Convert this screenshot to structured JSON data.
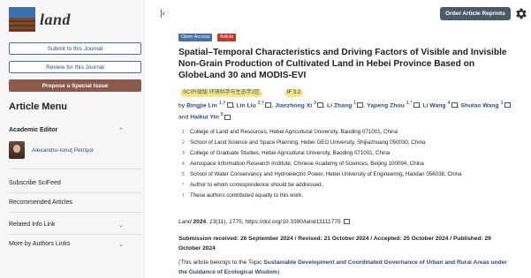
{
  "journal": {
    "name": "land"
  },
  "sidebar": {
    "submit_label": "Submit to this Journal",
    "review_label": "Review for this Journal",
    "special_label": "Propose a Special Issue",
    "menu_title": "Article Menu",
    "academic_editor": "Academic Editor",
    "editor_name": "Alexandru-Ionuţ Petrişor",
    "subscribe": "Subscribe SciFeed",
    "recommended": "Recommended Articles",
    "related": "Related Info Link",
    "more_authors": "More by Authors Links"
  },
  "header": {
    "order_button": "Order Article Reprints",
    "collapse_icon": "collapse-left-icon",
    "settings_icon": "gear-icon"
  },
  "article": {
    "badges": {
      "open_access": "Open Access",
      "type": "Article"
    },
    "title": "Spatial–Temporal Characteristics and Driving Factors of Visible and Invisible Non-Grain Production of Cultivated Land in Hebei Province Based on GlobeLand 30 and MODIS-EVI",
    "tag_sci": "SCI升级版 环境科学与生态学2区",
    "tag_if": "IF 3.2",
    "authors": [
      {
        "name": "Bingjie Lin",
        "sup": "1,†"
      },
      {
        "name": "Lin Liu",
        "sup": "2,†"
      },
      {
        "name": "Jianzhong Xi",
        "sup": "3"
      },
      {
        "name": "Li Zhang",
        "sup": "1"
      },
      {
        "name": "Yapeng Zhou",
        "sup": "1,*"
      },
      {
        "name": "Li Wang",
        "sup": "4"
      },
      {
        "name": "Shutao Wang",
        "sup": "1"
      },
      {
        "name": "Haikui Yin",
        "sup": "5"
      }
    ],
    "affiliations": [
      {
        "num": "1",
        "text": "College of Land and Resources, Hebei Agricultural University, Baoding 071001, China"
      },
      {
        "num": "2",
        "text": "School of Land Science and Space Planning, Hebei GEO University, Shijiazhuang 050030, China"
      },
      {
        "num": "3",
        "text": "College of Graduate Studies, Hebei Agricultural University, Baoding 071001, China"
      },
      {
        "num": "4",
        "text": "Aerospace Information Research Institute, Chinese Academy of Sciences, Beijing 100094, China"
      },
      {
        "num": "5",
        "text": "School of Water Conservancy and Hydroelectric Power, Hebei University of Engineering, Handan 056038, China"
      },
      {
        "num": "*",
        "text": "Author to whom correspondence should be addressed."
      },
      {
        "num": "†",
        "text": "These authors contributed equally to this work."
      }
    ],
    "citation": {
      "journal": "Land",
      "year": "2024",
      "volume": "13",
      "issue": "(11)",
      "page": ", 1775; ",
      "doi": "https://doi.org/10.3390/land13111775"
    },
    "dates": {
      "received": "Submission received: 26 September 2024",
      "revised": "Revised: 21 October 2024",
      "accepted": "Accepted: 25 October 2024",
      "published": "Published: 29 October 2024"
    },
    "topic": {
      "prefix": "(This article belongs to the Topic ",
      "link": "Sustainable Development and Coordinated Governance of Urban and Rural Areas under the Guidance of Ecological Wisdom",
      "suffix": ")"
    }
  }
}
